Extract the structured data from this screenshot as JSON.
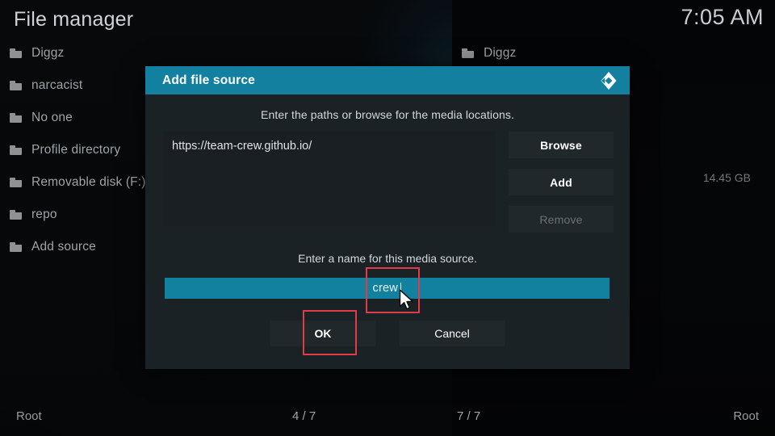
{
  "header": {
    "title": "File manager",
    "clock": "7:05 AM"
  },
  "left_panel": {
    "items": [
      {
        "label": "Diggz",
        "icon": "folder-icon"
      },
      {
        "label": "narcacist",
        "icon": "folder-icon"
      },
      {
        "label": "No one",
        "icon": "folder-icon"
      },
      {
        "label": "Profile directory",
        "icon": "folder-icon"
      },
      {
        "label": "Removable disk (F:)",
        "icon": "folder-icon"
      },
      {
        "label": "repo",
        "icon": "folder-icon"
      },
      {
        "label": "Add source",
        "icon": "folder-icon"
      }
    ]
  },
  "right_panel": {
    "items": [
      {
        "label": "Diggz",
        "icon": "folder-icon",
        "size": ""
      }
    ],
    "size_label": "14.45 GB"
  },
  "status_bar": {
    "left_root": "Root",
    "left_count": "4 / 7",
    "right_count": "7 / 7",
    "right_root": "Root"
  },
  "dialog": {
    "title": "Add file source",
    "logo_icon": "kodi-logo-icon",
    "paths_instruction": "Enter the paths or browse for the media locations.",
    "paths": [
      "https://team-crew.github.io/"
    ],
    "side_buttons": [
      {
        "label": "Browse",
        "disabled": false
      },
      {
        "label": "Add",
        "disabled": false
      },
      {
        "label": "Remove",
        "disabled": true
      }
    ],
    "name_instruction": "Enter a name for this media source.",
    "name_value": "crew",
    "footer_buttons": {
      "ok": "OK",
      "cancel": "Cancel"
    }
  },
  "annotations": {
    "highlight_color": "#e23b48",
    "boxes": [
      {
        "target": "name-field"
      },
      {
        "target": "ok-button"
      }
    ]
  },
  "colors": {
    "accent_blue": "#14809f",
    "field_blue": "#11819f",
    "dialog_bg": "#1b2226",
    "button_bg": "#21282c",
    "annotation_red": "#e23b48"
  }
}
